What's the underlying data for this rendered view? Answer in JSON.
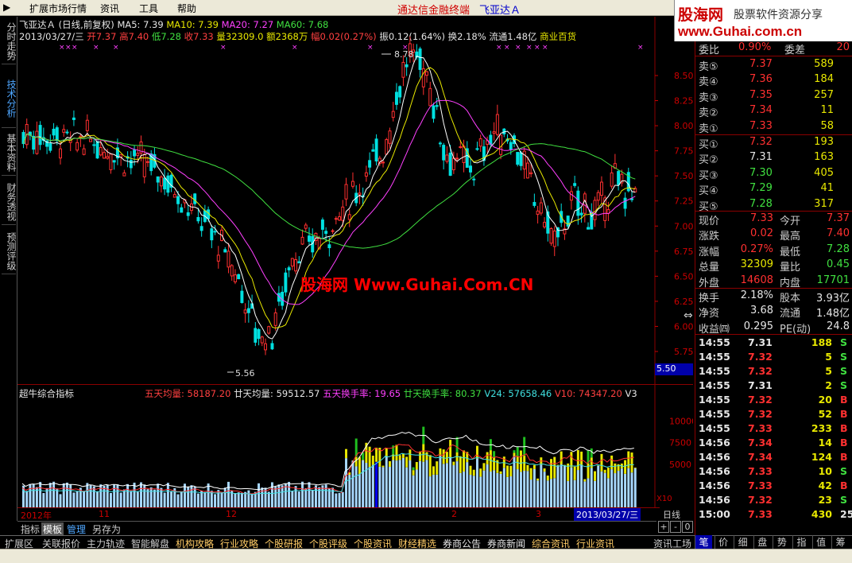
{
  "menu": {
    "items": [
      "扩展市场行情",
      "资讯",
      "工具",
      "帮助"
    ]
  },
  "app": {
    "title": "通达信金融终端",
    "stock_name": "飞亚达Ａ"
  },
  "logo": {
    "main": "股海网",
    "sub": "股票软件资源分享",
    "url": "www.Guhai.com.cn"
  },
  "left_tabs": [
    "分时走势",
    "技术分析",
    "基本资料",
    "财务透视",
    "预测评级"
  ],
  "chart": {
    "line1": {
      "name": "飞亚达Ａ",
      "mode": "(日线,前复权)",
      "ma5": "MA5: 7.39",
      "ma10": "MA10: 7.39",
      "ma20": "MA20: 7.27",
      "ma60": "MA60: 7.68"
    },
    "line2": {
      "date": "2013/03/27/三",
      "open": "开7.37",
      "high": "高7.40",
      "low": "低7.28",
      "close": "收7.33",
      "vol": "量32309.0",
      "amt": "额2368万",
      "chg": "幅0.02(0.27%)",
      "amp": "振0.12(1.64%)",
      "turn": "换2.18%",
      "float": "流通1.48亿",
      "sector": "商业百货"
    },
    "high_label": "8.78",
    "low_label": "5.56",
    "price_axis": [
      "8.50",
      "8.25",
      "8.00",
      "7.75",
      "7.50",
      "7.25",
      "7.00",
      "6.75",
      "6.50",
      "6.25",
      "6.00",
      "5.75"
    ],
    "current_price_flag": "5.50",
    "watermark": "股海网 Www.Guhai.Com.CN"
  },
  "indicator": {
    "name": "超牛综合指标",
    "v1": "五天均量: 58187.20",
    "v2": "廿天均量: 59512.57",
    "v3": "五天换手率: 19.65",
    "v4": "廿天换手率: 80.37",
    "v5": "V24: 57658.46",
    "v6": "V10: 74347.20",
    "v7": "V3",
    "axis": [
      "10000",
      "7500",
      "5000"
    ],
    "unit": "X10"
  },
  "date_axis": {
    "ticks": [
      "2012年",
      "11",
      "12",
      "2",
      "3"
    ],
    "current": "2013/03/27/三",
    "period": "日线"
  },
  "zoom": {
    "plus": "+",
    "minus": "-",
    "zero": "0"
  },
  "sub_tabs": [
    "指标",
    "模板",
    "管理",
    "另存为"
  ],
  "bottom_tabs": [
    "扩展区",
    "关联报价",
    "主力轨迹",
    "智能解盘",
    "机构攻略",
    "行业攻略",
    "个股研报",
    "个股评级",
    "个股资讯",
    "财经精选",
    "券商公告",
    "券商新闻",
    "综合资讯",
    "行业资讯",
    "资讯工场"
  ],
  "right_tabs": [
    "笔",
    "价",
    "细",
    "盘",
    "势",
    "指",
    "值",
    "筹"
  ],
  "orderbook": {
    "weibi": {
      "label": "委比",
      "value": "0.90%",
      "label2": "委差",
      "value2": "20"
    },
    "sells": [
      {
        "label": "卖⑤",
        "price": "7.37",
        "vol": "589"
      },
      {
        "label": "卖④",
        "price": "7.36",
        "vol": "184"
      },
      {
        "label": "卖③",
        "price": "7.35",
        "vol": "257"
      },
      {
        "label": "卖②",
        "price": "7.34",
        "vol": "11"
      },
      {
        "label": "卖①",
        "price": "7.33",
        "vol": "58"
      }
    ],
    "buys": [
      {
        "label": "买①",
        "price": "7.32",
        "vol": "193"
      },
      {
        "label": "买②",
        "price": "7.31",
        "vol": "163"
      },
      {
        "label": "买③",
        "price": "7.30",
        "vol": "405"
      },
      {
        "label": "买④",
        "price": "7.29",
        "vol": "41"
      },
      {
        "label": "买⑤",
        "price": "7.28",
        "vol": "317"
      }
    ]
  },
  "quote": {
    "rows": [
      {
        "l1": "现价",
        "v1": "7.33",
        "l2": "今开",
        "v2": "7.37"
      },
      {
        "l1": "涨跌",
        "v1": "0.02",
        "l2": "最高",
        "v2": "7.40"
      },
      {
        "l1": "涨幅",
        "v1": "0.27%",
        "l2": "最低",
        "v2": "7.28"
      },
      {
        "l1": "总量",
        "v1": "32309",
        "l2": "量比",
        "v2": "0.45"
      },
      {
        "l1": "外盘",
        "v1": "14608",
        "l2": "内盘",
        "v2": "17701"
      }
    ],
    "rows2": [
      {
        "l1": "换手",
        "v1": "2.18%",
        "l2": "股本",
        "v2": "3.93亿"
      },
      {
        "l1": "净资",
        "v1": "3.68",
        "l2": "流通",
        "v2": "1.48亿"
      },
      {
        "l1": "收益㈣",
        "v1": "0.295",
        "l2": "PE(动)",
        "v2": "24.8"
      }
    ]
  },
  "ticks": [
    {
      "t": "14:55",
      "p": "7.31",
      "v": "188",
      "s": "S"
    },
    {
      "t": "14:55",
      "p": "7.32",
      "v": "5",
      "s": "S"
    },
    {
      "t": "14:55",
      "p": "7.32",
      "v": "5",
      "s": "S"
    },
    {
      "t": "14:55",
      "p": "7.31",
      "v": "2",
      "s": "S"
    },
    {
      "t": "14:55",
      "p": "7.32",
      "v": "20",
      "s": "B"
    },
    {
      "t": "14:55",
      "p": "7.32",
      "v": "52",
      "s": "B"
    },
    {
      "t": "14:55",
      "p": "7.33",
      "v": "233",
      "s": "B"
    },
    {
      "t": "14:56",
      "p": "7.34",
      "v": "14",
      "s": "B"
    },
    {
      "t": "14:56",
      "p": "7.34",
      "v": "124",
      "s": "B"
    },
    {
      "t": "14:56",
      "p": "7.33",
      "v": "10",
      "s": "S"
    },
    {
      "t": "14:56",
      "p": "7.33",
      "v": "42",
      "s": "B"
    },
    {
      "t": "14:56",
      "p": "7.32",
      "v": "23",
      "s": "S"
    },
    {
      "t": "15:00",
      "p": "7.33",
      "v": "430",
      "s": "25"
    }
  ],
  "colors": {
    "up": "#ff3030",
    "down": "#00e0e0",
    "ma5": "#ffffff",
    "ma10": "#e8e800",
    "ma20": "#ff40ff",
    "ma60": "#40e040"
  }
}
